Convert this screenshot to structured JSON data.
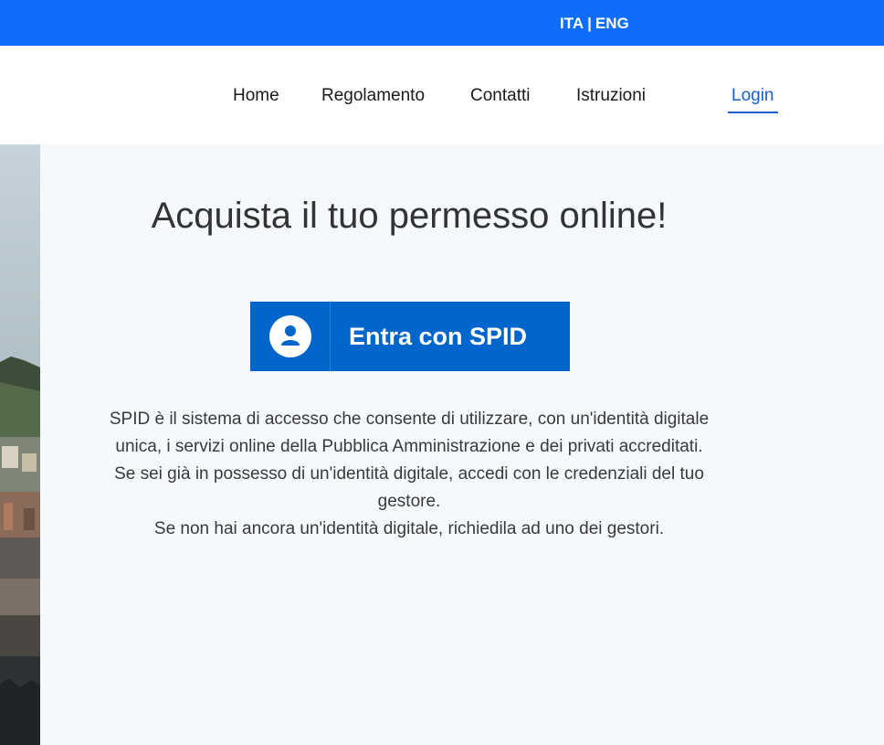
{
  "topbar": {
    "lang_ita": "ITA",
    "lang_sep": "|",
    "lang_eng": "ENG",
    "color": "#0d6efd"
  },
  "nav": {
    "items": [
      {
        "label": "Home"
      },
      {
        "label": "Regolamento"
      },
      {
        "label": "Contatti"
      },
      {
        "label": "Istruzioni"
      }
    ],
    "login": "Login",
    "active_color": "#1a5fd0"
  },
  "main": {
    "headline": "Acquista il tuo permesso online!",
    "spid_button": {
      "label": "Entra con SPID",
      "icon": "user-icon",
      "color": "#0066cc"
    },
    "description": [
      "SPID è il sistema di accesso che consente di utilizzare, con un'identità digitale unica, i servizi online della Pubblica Amministrazione e dei privati accreditati.",
      "Se sei già in possesso di un'identità digitale, accedi con le credenziali del tuo gestore.",
      "Se non hai ancora un'identità digitale, richiedila ad uno dei gestori."
    ]
  }
}
